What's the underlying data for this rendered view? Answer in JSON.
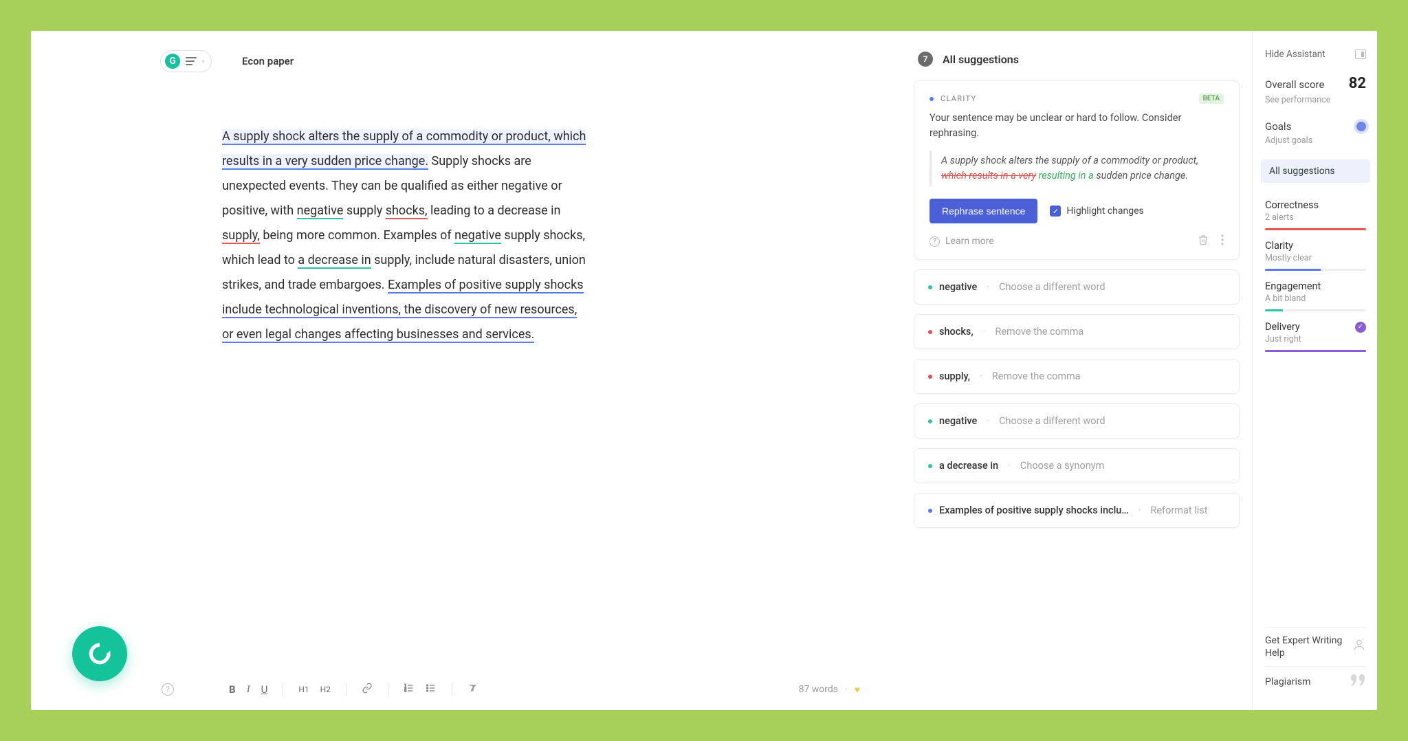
{
  "doc": {
    "title": "Econ paper",
    "word_count": "87 words",
    "segments": [
      {
        "text": "A supply shock alters the supply of a commodity or product, which results in a very sudden price change.",
        "cls": "hl-blue"
      },
      {
        "text": " Supply shocks are unexpected events. They can be qualified as either negative or positive, with "
      },
      {
        "text": "negative",
        "cls": "ul-teal"
      },
      {
        "text": " supply "
      },
      {
        "text": "shocks,",
        "cls": "ul-red"
      },
      {
        "text": " leading to a decrease in "
      },
      {
        "text": "supply,",
        "cls": "ul-red"
      },
      {
        "text": " being more common. Examples of "
      },
      {
        "text": "negative",
        "cls": "ul-teal"
      },
      {
        "text": " supply shocks, which lead to "
      },
      {
        "text": "a decrease in",
        "cls": "ul-teal"
      },
      {
        "text": " supply, include natural disasters, union strikes, and trade embargoes. "
      },
      {
        "text": "Examples of positive supply shocks include technological inventions, the discovery of new resources, or even legal changes affecting businesses and services.",
        "cls": "ul-blue"
      }
    ]
  },
  "suggestions": {
    "count": "7",
    "title": "All suggestions",
    "expanded": {
      "tag": "CLARITY",
      "beta": "BETA",
      "desc": "Your sentence may be unclear or hard to follow. Consider rephrasing.",
      "quote_pre": "A supply shock alters the supply of a commodity or product, ",
      "quote_del": "which results in a very",
      "quote_ins": " resulting in a",
      "quote_post": " sudden price change.",
      "button": "Rephrase sentence",
      "highlight": "Highlight changes",
      "learn": "Learn more"
    },
    "items": [
      {
        "dot": "teal",
        "word": "negative",
        "msg": "Choose a different word"
      },
      {
        "dot": "red",
        "word": "shocks,",
        "msg": "Remove the comma"
      },
      {
        "dot": "red",
        "word": "supply,",
        "msg": "Remove the comma"
      },
      {
        "dot": "teal",
        "word": "negative",
        "msg": "Choose a different word"
      },
      {
        "dot": "teal",
        "word": "a decrease in",
        "msg": "Choose a synonym"
      },
      {
        "dot": "blue",
        "word": "Examples of positive supply shocks inclu…",
        "msg": "Reformat list"
      }
    ]
  },
  "sidebar": {
    "hide": "Hide Assistant",
    "score_label": "Overall score",
    "score": "82",
    "score_sub": "See performance",
    "goals": "Goals",
    "goals_sub": "Adjust goals",
    "all": "All suggestions",
    "metrics": [
      {
        "title": "Correctness",
        "sub": "2 alerts",
        "bar": "bar-red"
      },
      {
        "title": "Clarity",
        "sub": "Mostly clear",
        "bar": "bar-blue"
      },
      {
        "title": "Engagement",
        "sub": "A bit bland",
        "bar": "bar-teal"
      },
      {
        "title": "Delivery",
        "sub": "Just right",
        "bar": "bar-purple",
        "check": true
      }
    ],
    "expert": "Get Expert Writing Help",
    "plagiarism": "Plagiarism"
  },
  "toolbar": {
    "bold": "B",
    "italic": "I",
    "underline": "U",
    "h1": "H1",
    "h2": "H2"
  }
}
